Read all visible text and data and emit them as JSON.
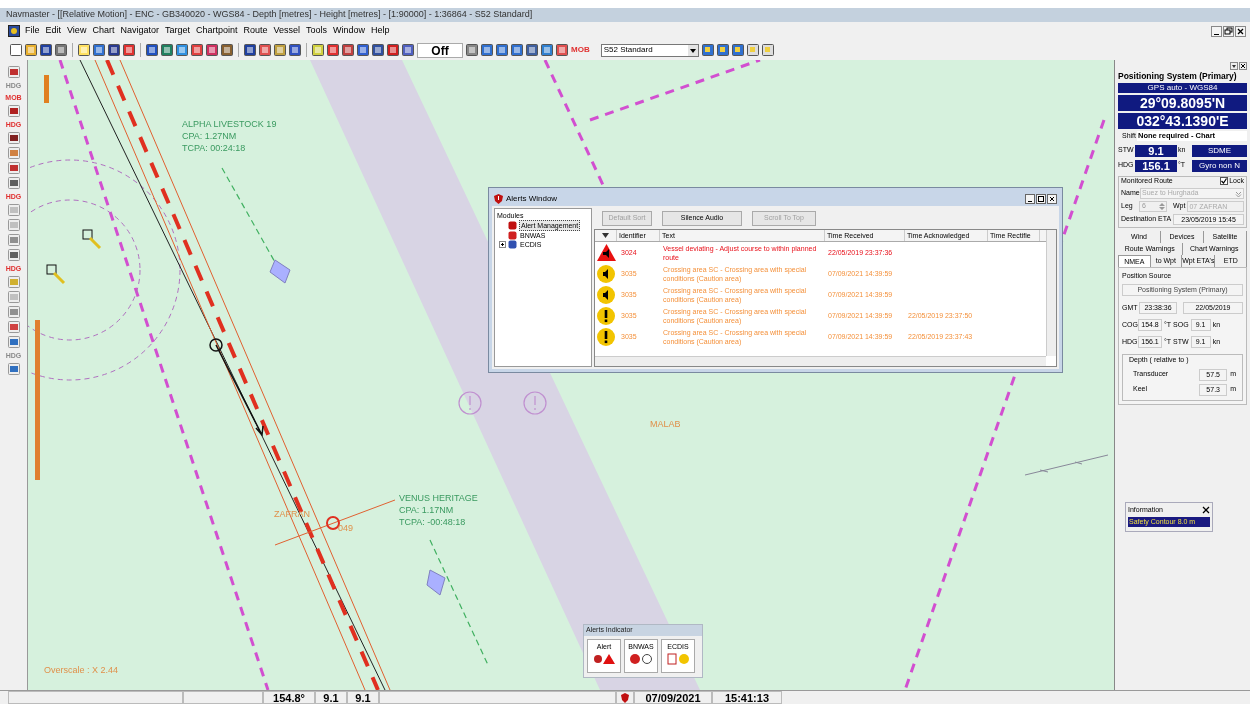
{
  "window": {
    "title": "Navmaster - [[Relative Motion] - ENC - GB340020 - WGS84 - Depth [metres] - Height [metres] - [1:90000] - 1:36864 - S52 Standard]"
  },
  "menu": [
    "File",
    "Edit",
    "View",
    "Chart",
    "Navigator",
    "Target",
    "Chartpoint",
    "Route",
    "Vessel",
    "Tools",
    "Window",
    "Help"
  ],
  "toolbar": {
    "display_mode": "Off",
    "mob": "MOB",
    "palette": "S52 Standard"
  },
  "left_toolbar": [
    {
      "kind": "icon"
    },
    {
      "kind": "label",
      "text": "HDG",
      "disabled": true
    },
    {
      "kind": "label",
      "text": "MOB",
      "disabled": false
    },
    {
      "kind": "icon"
    },
    {
      "kind": "label",
      "text": "HDG",
      "disabled": false
    },
    {
      "kind": "icon"
    },
    {
      "kind": "icon"
    },
    {
      "kind": "icon"
    },
    {
      "kind": "icon"
    },
    {
      "kind": "label",
      "text": "HDG",
      "disabled": false
    },
    {
      "kind": "icon"
    },
    {
      "kind": "icon"
    },
    {
      "kind": "icon"
    },
    {
      "kind": "icon"
    },
    {
      "kind": "label",
      "text": "HDG",
      "disabled": false
    },
    {
      "kind": "icon"
    },
    {
      "kind": "icon"
    },
    {
      "kind": "icon"
    },
    {
      "kind": "icon"
    },
    {
      "kind": "icon"
    },
    {
      "kind": "label",
      "text": "HDG",
      "disabled": true
    },
    {
      "kind": "icon"
    }
  ],
  "chart": {
    "targets": [
      {
        "name": "ALPHA LIVESTOCK 19",
        "cpa": "CPA: 1.27NM",
        "tcpa": "TCPA: 00:24:18"
      },
      {
        "name": "VENUS HERITAGE",
        "cpa": "CPA: 1.17NM",
        "tcpa": "TCPA: -00:48:18"
      }
    ],
    "places": [
      {
        "kind": "malab",
        "text": "MALAB"
      },
      {
        "kind": "zafran",
        "text": "ZAFRAN"
      },
      {
        "kind": "wpt",
        "text": "049"
      }
    ],
    "overscale": "Overscale : X 2.44"
  },
  "alerts_window": {
    "title": "Alerts Window",
    "modules_label": "Modules",
    "modules": [
      {
        "label": "Alert Management",
        "selected": true,
        "expandable": false
      },
      {
        "label": "BNWAS",
        "selected": false,
        "expandable": false
      },
      {
        "label": "ECDIS",
        "selected": false,
        "expandable": true
      }
    ],
    "buttons": [
      {
        "label": "Default Sort",
        "disabled": true
      },
      {
        "label": "Silence Audio",
        "disabled": false
      },
      {
        "label": "Scroll To Top",
        "disabled": true
      }
    ],
    "columns": [
      "Identifier",
      "Text",
      "Time Received",
      "Time Acknowledged",
      "Time Rectifie"
    ],
    "rows": [
      {
        "kind": "alarm",
        "identifier": "3024",
        "text": "Vessel deviating - Adjust course to within planned route",
        "received": "22/05/2019 23:37:36",
        "acknowledged": ""
      },
      {
        "kind": "caution",
        "identifier": "3035",
        "text": "Crossing area SC - Crossing area with special conditions (Caution area)",
        "received": "07/09/2021 14:39:59",
        "acknowledged": ""
      },
      {
        "kind": "caution",
        "identifier": "3035",
        "text": "Crossing area SC - Crossing area with special conditions (Caution area)",
        "received": "07/09/2021 14:39:59",
        "acknowledged": ""
      },
      {
        "kind": "caution_ack",
        "identifier": "3035",
        "text": "Crossing area SC - Crossing area with special conditions (Caution area)",
        "received": "07/09/2021 14:39:59",
        "acknowledged": "22/05/2019 23:37:50"
      },
      {
        "kind": "caution_ack",
        "identifier": "3035",
        "text": "Crossing area SC - Crossing area with special conditions (Caution area)",
        "received": "07/09/2021 14:39:59",
        "acknowledged": "22/05/2019 23:37:43"
      }
    ]
  },
  "alerts_indicator": {
    "title": "Alerts Indicator",
    "groups": [
      "Alert",
      "BNWAS",
      "ECDIS"
    ]
  },
  "information": {
    "title": "Information",
    "value": "Safety Contour 8.0 m"
  },
  "positioning": {
    "title": "Positioning System (Primary)",
    "source": "GPS auto - WGS84",
    "lat": "29°09.8095'N",
    "lon": "032°43.1390'E",
    "shift_label": "Shift",
    "shift": "None required - Chart",
    "stw_label": "STW",
    "stw": "9.1",
    "stw_unit": "kn",
    "stw_source": "SDME",
    "hdg_label": "HDG",
    "hdg": "156.1",
    "hdg_unit": "°T",
    "hdg_source": "Gyro non N"
  },
  "route": {
    "title": "Monitored Route",
    "lock_label": "Lock",
    "lock": true,
    "name_label": "Name",
    "name": "Suez to Hurghada",
    "leg_label": "Leg",
    "leg": "6",
    "wpt_label": "Wpt",
    "wpt": "07 ZAFRAN",
    "eta_label": "Destination ETA",
    "eta": "23/05/2019 15:45"
  },
  "tabs": [
    [
      {
        "label": "Wind",
        "selected": false
      },
      {
        "label": "Devices",
        "selected": false
      },
      {
        "label": "Satellite",
        "selected": false
      }
    ],
    [
      {
        "label": "Route Warnings",
        "selected": false
      },
      {
        "label": "Chart Warnings",
        "selected": false
      }
    ],
    [
      {
        "label": "NMEA",
        "selected": true
      },
      {
        "label": "to Wpt",
        "selected": false
      },
      {
        "label": "Wpt ETA's",
        "selected": false
      },
      {
        "label": "ETD",
        "selected": false
      }
    ]
  ],
  "nmea": {
    "source_label": "Position Source",
    "source": "Positioning System (Primary)",
    "gmt_label": "GMT",
    "gmt": "23:38:36",
    "date": "22/05/2019",
    "rows": [
      {
        "label": "COG",
        "value": "154.8",
        "unit": "°T",
        "label2": "SOG",
        "value2": "9.1",
        "unit2": "kn"
      },
      {
        "label": "HDG",
        "value": "156.1",
        "unit": "°T",
        "label2": "STW",
        "value2": "9.1",
        "unit2": "kn"
      }
    ],
    "depth_title": "Depth ( relative to )",
    "depths": [
      {
        "label": "Transducer",
        "value": "57.5",
        "unit": "m"
      },
      {
        "label": "Keel",
        "value": "57.3",
        "unit": "m"
      }
    ]
  },
  "status_bar": [
    "154.8°",
    "9.1",
    "9.1",
    "07/09/2021",
    "15:41:13"
  ]
}
